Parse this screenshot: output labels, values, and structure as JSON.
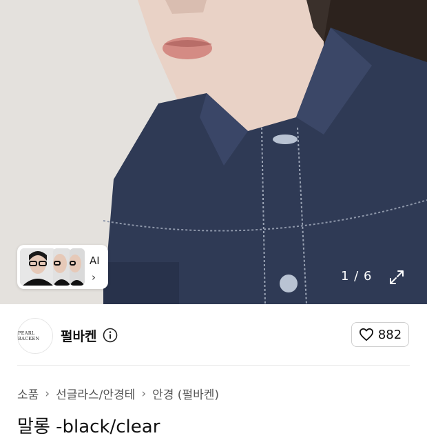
{
  "hero": {
    "image_icon": "product-photo",
    "counter": "1 / 6",
    "expand_icon": "expand-icon",
    "ai_card": {
      "label": "AI",
      "chevron": "›"
    }
  },
  "shop": {
    "logo_text": "PEARL BACKEN",
    "name": "펄바켄",
    "info_icon": "info-icon",
    "likes": "882",
    "heart_icon": "heart-outline-icon"
  },
  "breadcrumb": [
    "소품",
    "선글라스/안경테",
    "안경 (펄바켄)"
  ],
  "product": {
    "title": "말롱 -black/clear"
  }
}
